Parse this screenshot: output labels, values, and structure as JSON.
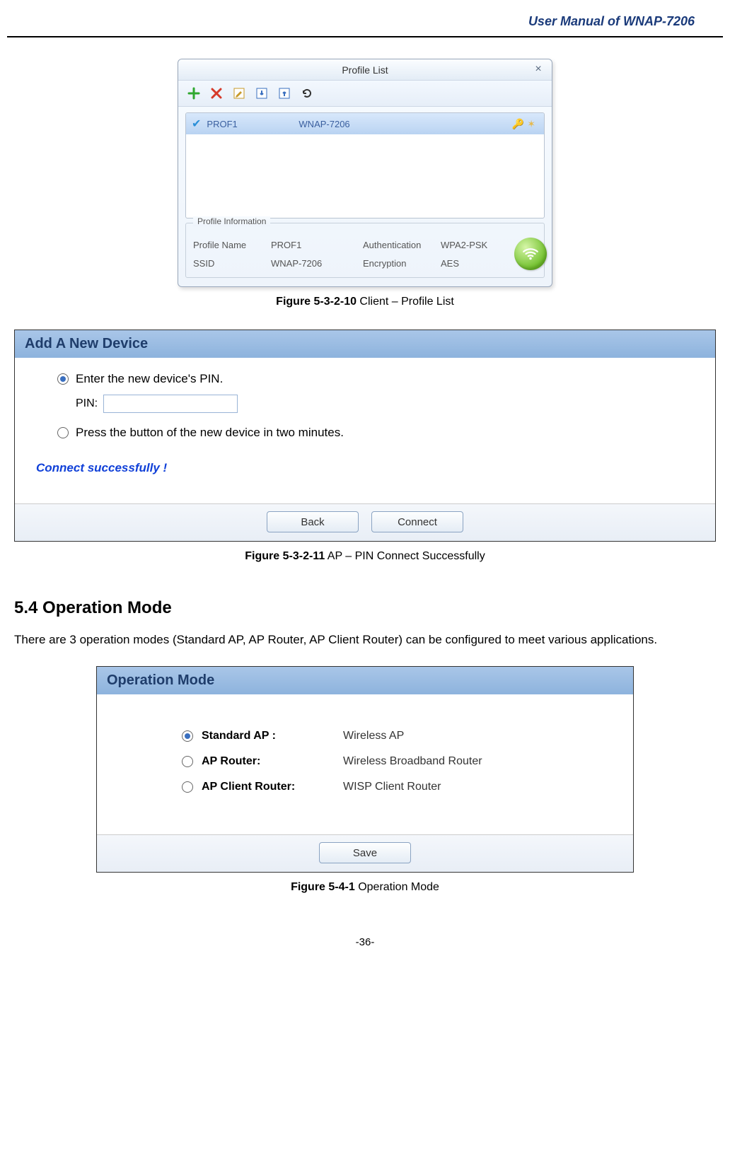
{
  "header": {
    "title": "User Manual of WNAP-7206"
  },
  "fig1": {
    "window_title": "Profile List",
    "toolbar_icons": [
      "plus-icon",
      "delete-icon",
      "edit-icon",
      "import-icon",
      "export-icon",
      "refresh-icon"
    ],
    "row": {
      "name": "PROF1",
      "ssid": "WNAP-7206"
    },
    "info": {
      "legend": "Profile Information",
      "profile_name_label": "Profile Name",
      "profile_name_value": "PROF1",
      "ssid_label": "SSID",
      "ssid_value": "WNAP-7206",
      "auth_label": "Authentication",
      "auth_value": "WPA2-PSK",
      "enc_label": "Encryption",
      "enc_value": "AES"
    },
    "caption_bold": "Figure 5-3-2-10",
    "caption_rest": " Client – Profile List"
  },
  "fig2": {
    "title": "Add A New Device",
    "opt1": "Enter the new device's PIN.",
    "pin_label": "PIN:",
    "pin_value": "",
    "opt2": "Press the button of the new device in two minutes.",
    "success_msg": "Connect successfully !",
    "back": "Back",
    "connect": "Connect",
    "caption_bold": "Figure 5-3-2-11",
    "caption_rest": " AP – PIN Connect Successfully"
  },
  "section": {
    "heading": "5.4  Operation Mode",
    "para": "There are 3 operation modes (Standard AP, AP Router, AP Client Router) can be configured to meet various applications."
  },
  "fig3": {
    "title": "Operation Mode",
    "rows": [
      {
        "checked": true,
        "label": "Standard AP :",
        "desc": "Wireless AP"
      },
      {
        "checked": false,
        "label": "AP Router:",
        "desc": "Wireless Broadband Router"
      },
      {
        "checked": false,
        "label": "AP Client Router:",
        "desc": "WISP Client Router"
      }
    ],
    "save": "Save",
    "caption_bold": "Figure 5-4-1",
    "caption_rest": " Operation Mode"
  },
  "footer": {
    "page": "-36-"
  }
}
